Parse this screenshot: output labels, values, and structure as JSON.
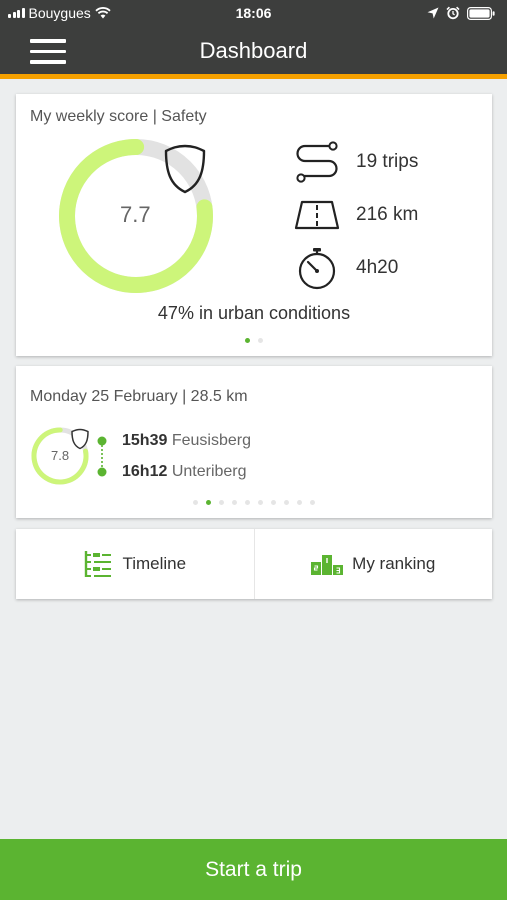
{
  "status_bar": {
    "carrier": "Bouygues",
    "time": "18:06"
  },
  "app_bar": {
    "title": "Dashboard"
  },
  "weekly_card": {
    "title": "My weekly score | Safety",
    "score": "7.7",
    "score_level": 0.77,
    "stats": {
      "trips": "19",
      "trips_unit": "trips",
      "distance": "216",
      "distance_unit": "km",
      "duration": "4h20"
    },
    "urban_percent": "47%",
    "urban_text": "in urban conditions"
  },
  "day_card": {
    "title": "Monday 25 February | 28.5 km",
    "score": "7.8",
    "score_level": 0.78,
    "trip": {
      "start_time": "15h39",
      "start_place": "Feusisberg",
      "end_time": "16h12",
      "end_place": "Unteriberg"
    }
  },
  "actions": {
    "timeline_label": "Timeline",
    "ranking_label": "My ranking"
  },
  "start_trip_label": "Start a trip",
  "colors": {
    "accent_orange": "#f5a000",
    "brand_green": "#5bb431",
    "score_lime": "#cdf57a",
    "app_bar": "#3d3e3d"
  }
}
